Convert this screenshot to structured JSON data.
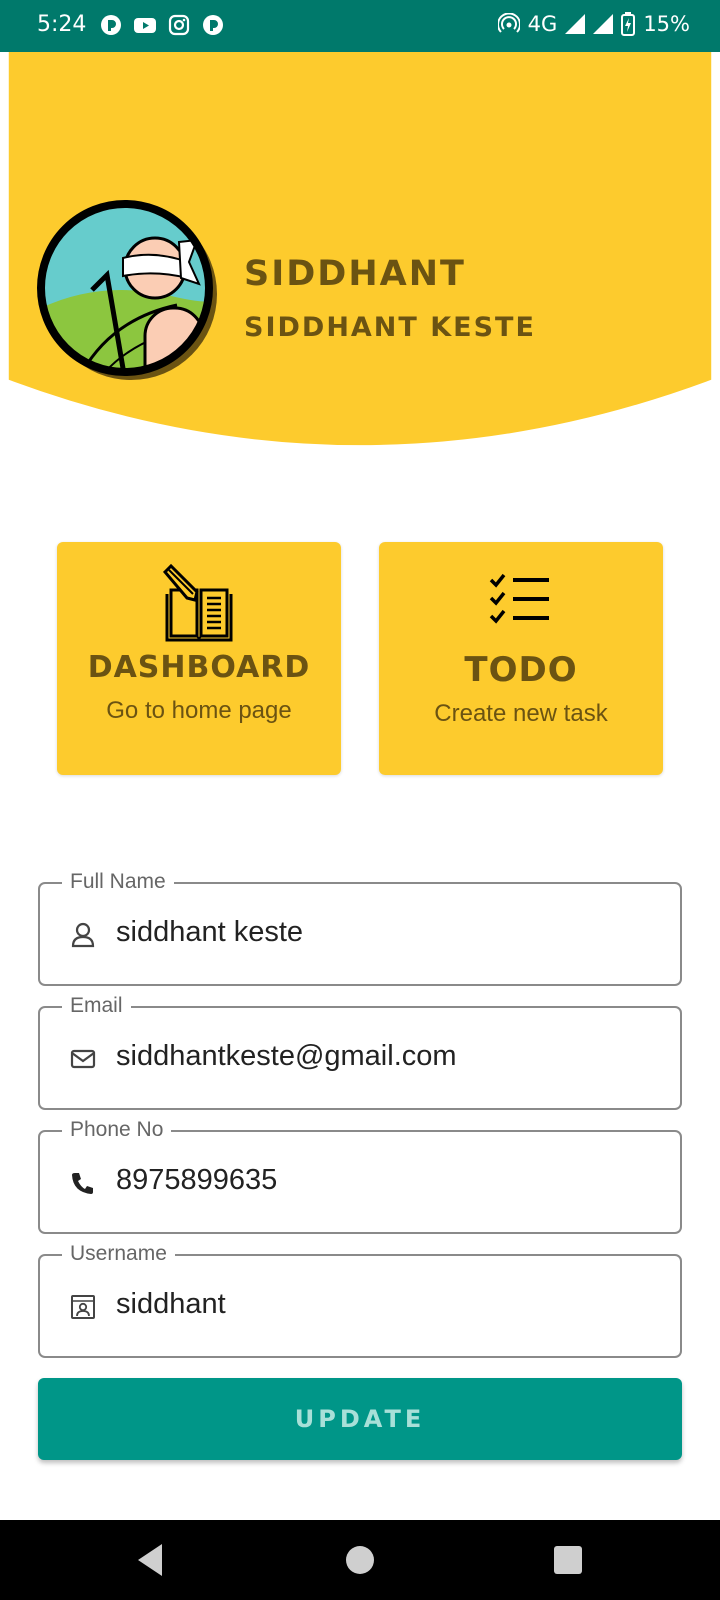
{
  "status_bar": {
    "time": "5:24",
    "network": "4G",
    "battery": "15%",
    "icons": [
      "notification-icon",
      "youtube-icon",
      "instagram-icon",
      "notification-icon",
      "hotspot-icon",
      "signal-icon",
      "signal-icon",
      "battery-charging-icon"
    ]
  },
  "header": {
    "name": "SIDDHANT",
    "full_name": "SIDDHANT KESTE",
    "background_color": "#FDCB2D",
    "text_color": "#6b5312"
  },
  "cards": {
    "dashboard": {
      "title": "DASHBOARD",
      "subtitle": "Go to home page",
      "icon": "notebook-pencil-icon"
    },
    "todo": {
      "title": "TODO",
      "subtitle": "Create new task",
      "icon": "checklist-icon"
    }
  },
  "form": {
    "full_name": {
      "label": "Full Name",
      "value": "siddhant keste",
      "icon": "person-icon"
    },
    "email": {
      "label": "Email",
      "value": "siddhantkeste@gmail.com",
      "icon": "mail-icon"
    },
    "phone": {
      "label": "Phone No",
      "value": "8975899635",
      "icon": "phone-icon"
    },
    "username": {
      "label": "Username",
      "value": "siddhant",
      "icon": "id-card-icon"
    }
  },
  "update_button": {
    "label": "UPDATE",
    "color": "#009688"
  },
  "nav_bar": {
    "buttons": [
      "back-icon",
      "home-icon",
      "recents-icon"
    ]
  }
}
